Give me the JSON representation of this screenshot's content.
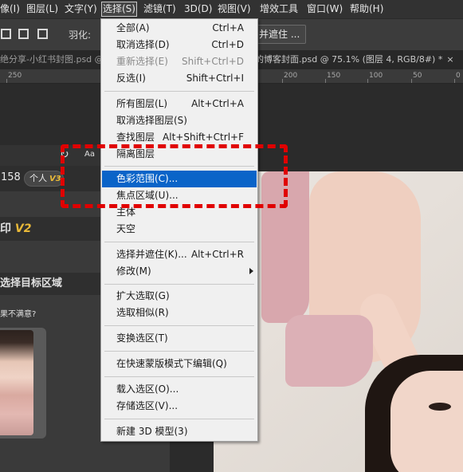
{
  "menubar": {
    "items": [
      "像(I)",
      "图层(L)",
      "文字(Y)",
      "选择(S)",
      "滤镜(T)",
      "3D(D)",
      "视图(V)",
      "增效工具",
      "窗口(W)",
      "帮助(H)"
    ]
  },
  "options_bar": {
    "feather_label": "羽化:",
    "refine_button": "并遮住 ..."
  },
  "tabs": {
    "left": "绝分享-小红书封图.psd @",
    "right": "的博客封面.psd @ 75.1% (图层 4, RGB/8#) *",
    "close": "×"
  },
  "ruler": {
    "ticks": [
      "250",
      "200",
      "150",
      "100",
      "50",
      "0"
    ]
  },
  "menu": {
    "items": [
      {
        "label": "全部(A)",
        "shortcut": "Ctrl+A"
      },
      {
        "label": "取消选择(D)",
        "shortcut": "Ctrl+D"
      },
      {
        "label": "重新选择(E)",
        "shortcut": "Shift+Ctrl+D"
      },
      {
        "label": "反选(I)",
        "shortcut": "Shift+Ctrl+I"
      },
      {
        "label": "所有图层(L)",
        "shortcut": "Alt+Ctrl+A"
      },
      {
        "label": "取消选择图层(S)",
        "shortcut": ""
      },
      {
        "label": "查找图层",
        "shortcut": "Alt+Shift+Ctrl+F"
      },
      {
        "label": "隔离图层",
        "shortcut": ""
      },
      {
        "label": "色彩范围(C)...",
        "shortcut": ""
      },
      {
        "label": "焦点区域(U)...",
        "shortcut": ""
      },
      {
        "label": "主体",
        "shortcut": ""
      },
      {
        "label": "天空",
        "shortcut": ""
      },
      {
        "label": "选择并遮住(K)...",
        "shortcut": "Alt+Ctrl+R"
      },
      {
        "label": "修改(M)",
        "shortcut": ""
      },
      {
        "label": "扩大选取(G)",
        "shortcut": ""
      },
      {
        "label": "选取相似(R)",
        "shortcut": ""
      },
      {
        "label": "变换选区(T)",
        "shortcut": ""
      },
      {
        "label": "在快速蒙版模式下编辑(Q)",
        "shortcut": ""
      },
      {
        "label": "载入选区(O)...",
        "shortcut": ""
      },
      {
        "label": "存储选区(V)...",
        "shortcut": ""
      },
      {
        "label": "新建 3D 模型(3)",
        "shortcut": ""
      }
    ]
  },
  "panel": {
    "count": "158",
    "badge_label": "个人",
    "badge_version": "V3",
    "aa": "Aa",
    "title": "印",
    "title_version": "V2",
    "section_title": "选择目标区域",
    "hint": "果不满意?"
  },
  "colors": {
    "highlight": "#0a64c8",
    "annotation": "#e00000",
    "accent_gold": "#e8b838"
  }
}
